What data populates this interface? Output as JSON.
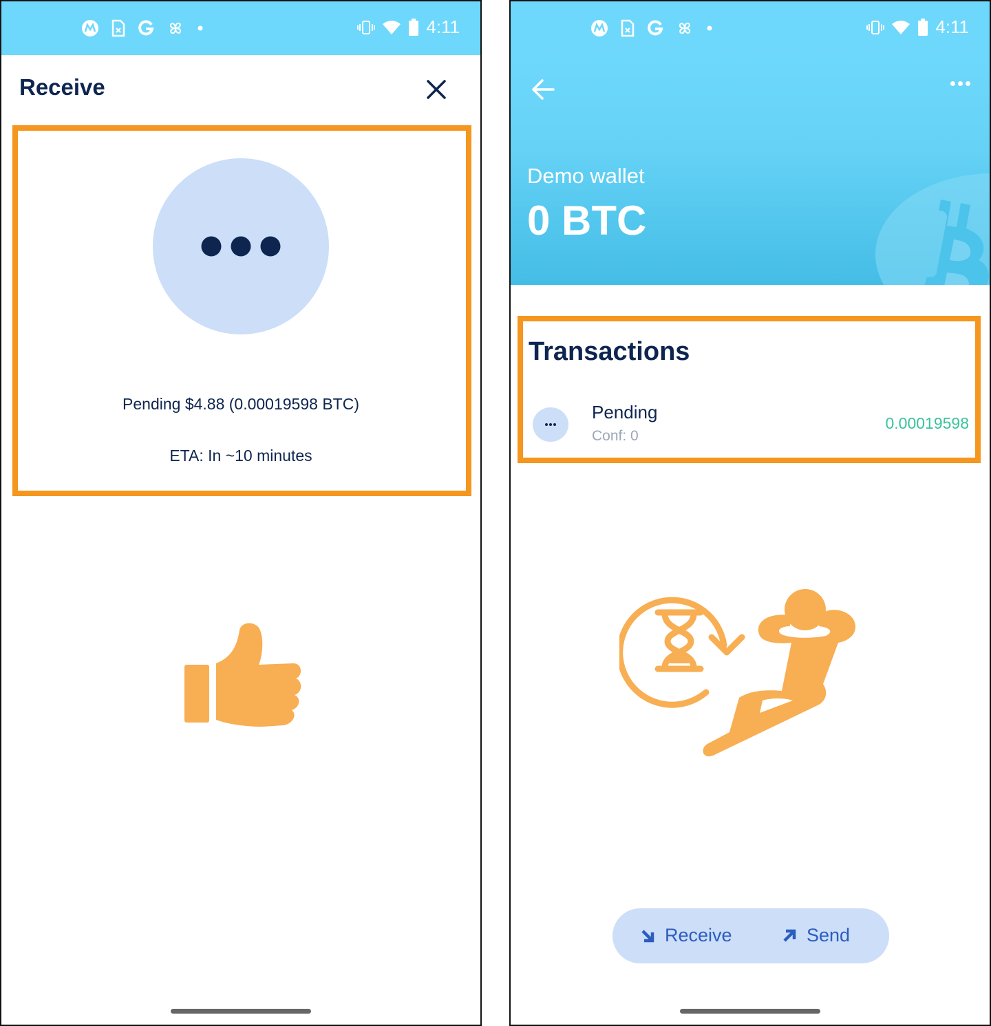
{
  "status_bar": {
    "time": "4:11",
    "left_icons": [
      "motorola-icon",
      "sim-icon",
      "google-icon",
      "pinwheel-icon",
      "notification-dot-icon"
    ],
    "right_icons": [
      "vibrate-icon",
      "wifi-icon",
      "battery-icon"
    ]
  },
  "receive_screen": {
    "title": "Receive",
    "close_icon": "close-icon",
    "status_icon": "pending-dots-icon",
    "pending_text": "Pending $4.88 (0.00019598 BTC)",
    "eta_text": "ETA: In ~10 minutes",
    "illustration": "thumbs-up-icon"
  },
  "wallet_screen": {
    "back_icon": "arrow-left-icon",
    "more_icon": "more-horizontal-icon",
    "wallet_name": "Demo wallet",
    "balance": "0 BTC",
    "section_title": "Transactions",
    "transactions": [
      {
        "label": "Pending",
        "conf": "Conf: 0",
        "amount": "0.00019598"
      }
    ],
    "illustration": "relax-waiting-icon",
    "actions": {
      "receive_label": "Receive",
      "send_label": "Send"
    }
  },
  "colors": {
    "status_bar": "#6dd8fb",
    "highlight": "#f5961e",
    "navy": "#0e2550",
    "light_blue": "#ccdef8",
    "amount_green": "#3cc39b",
    "illustration_orange": "#f8ae52",
    "action_text": "#2c5cbf"
  }
}
